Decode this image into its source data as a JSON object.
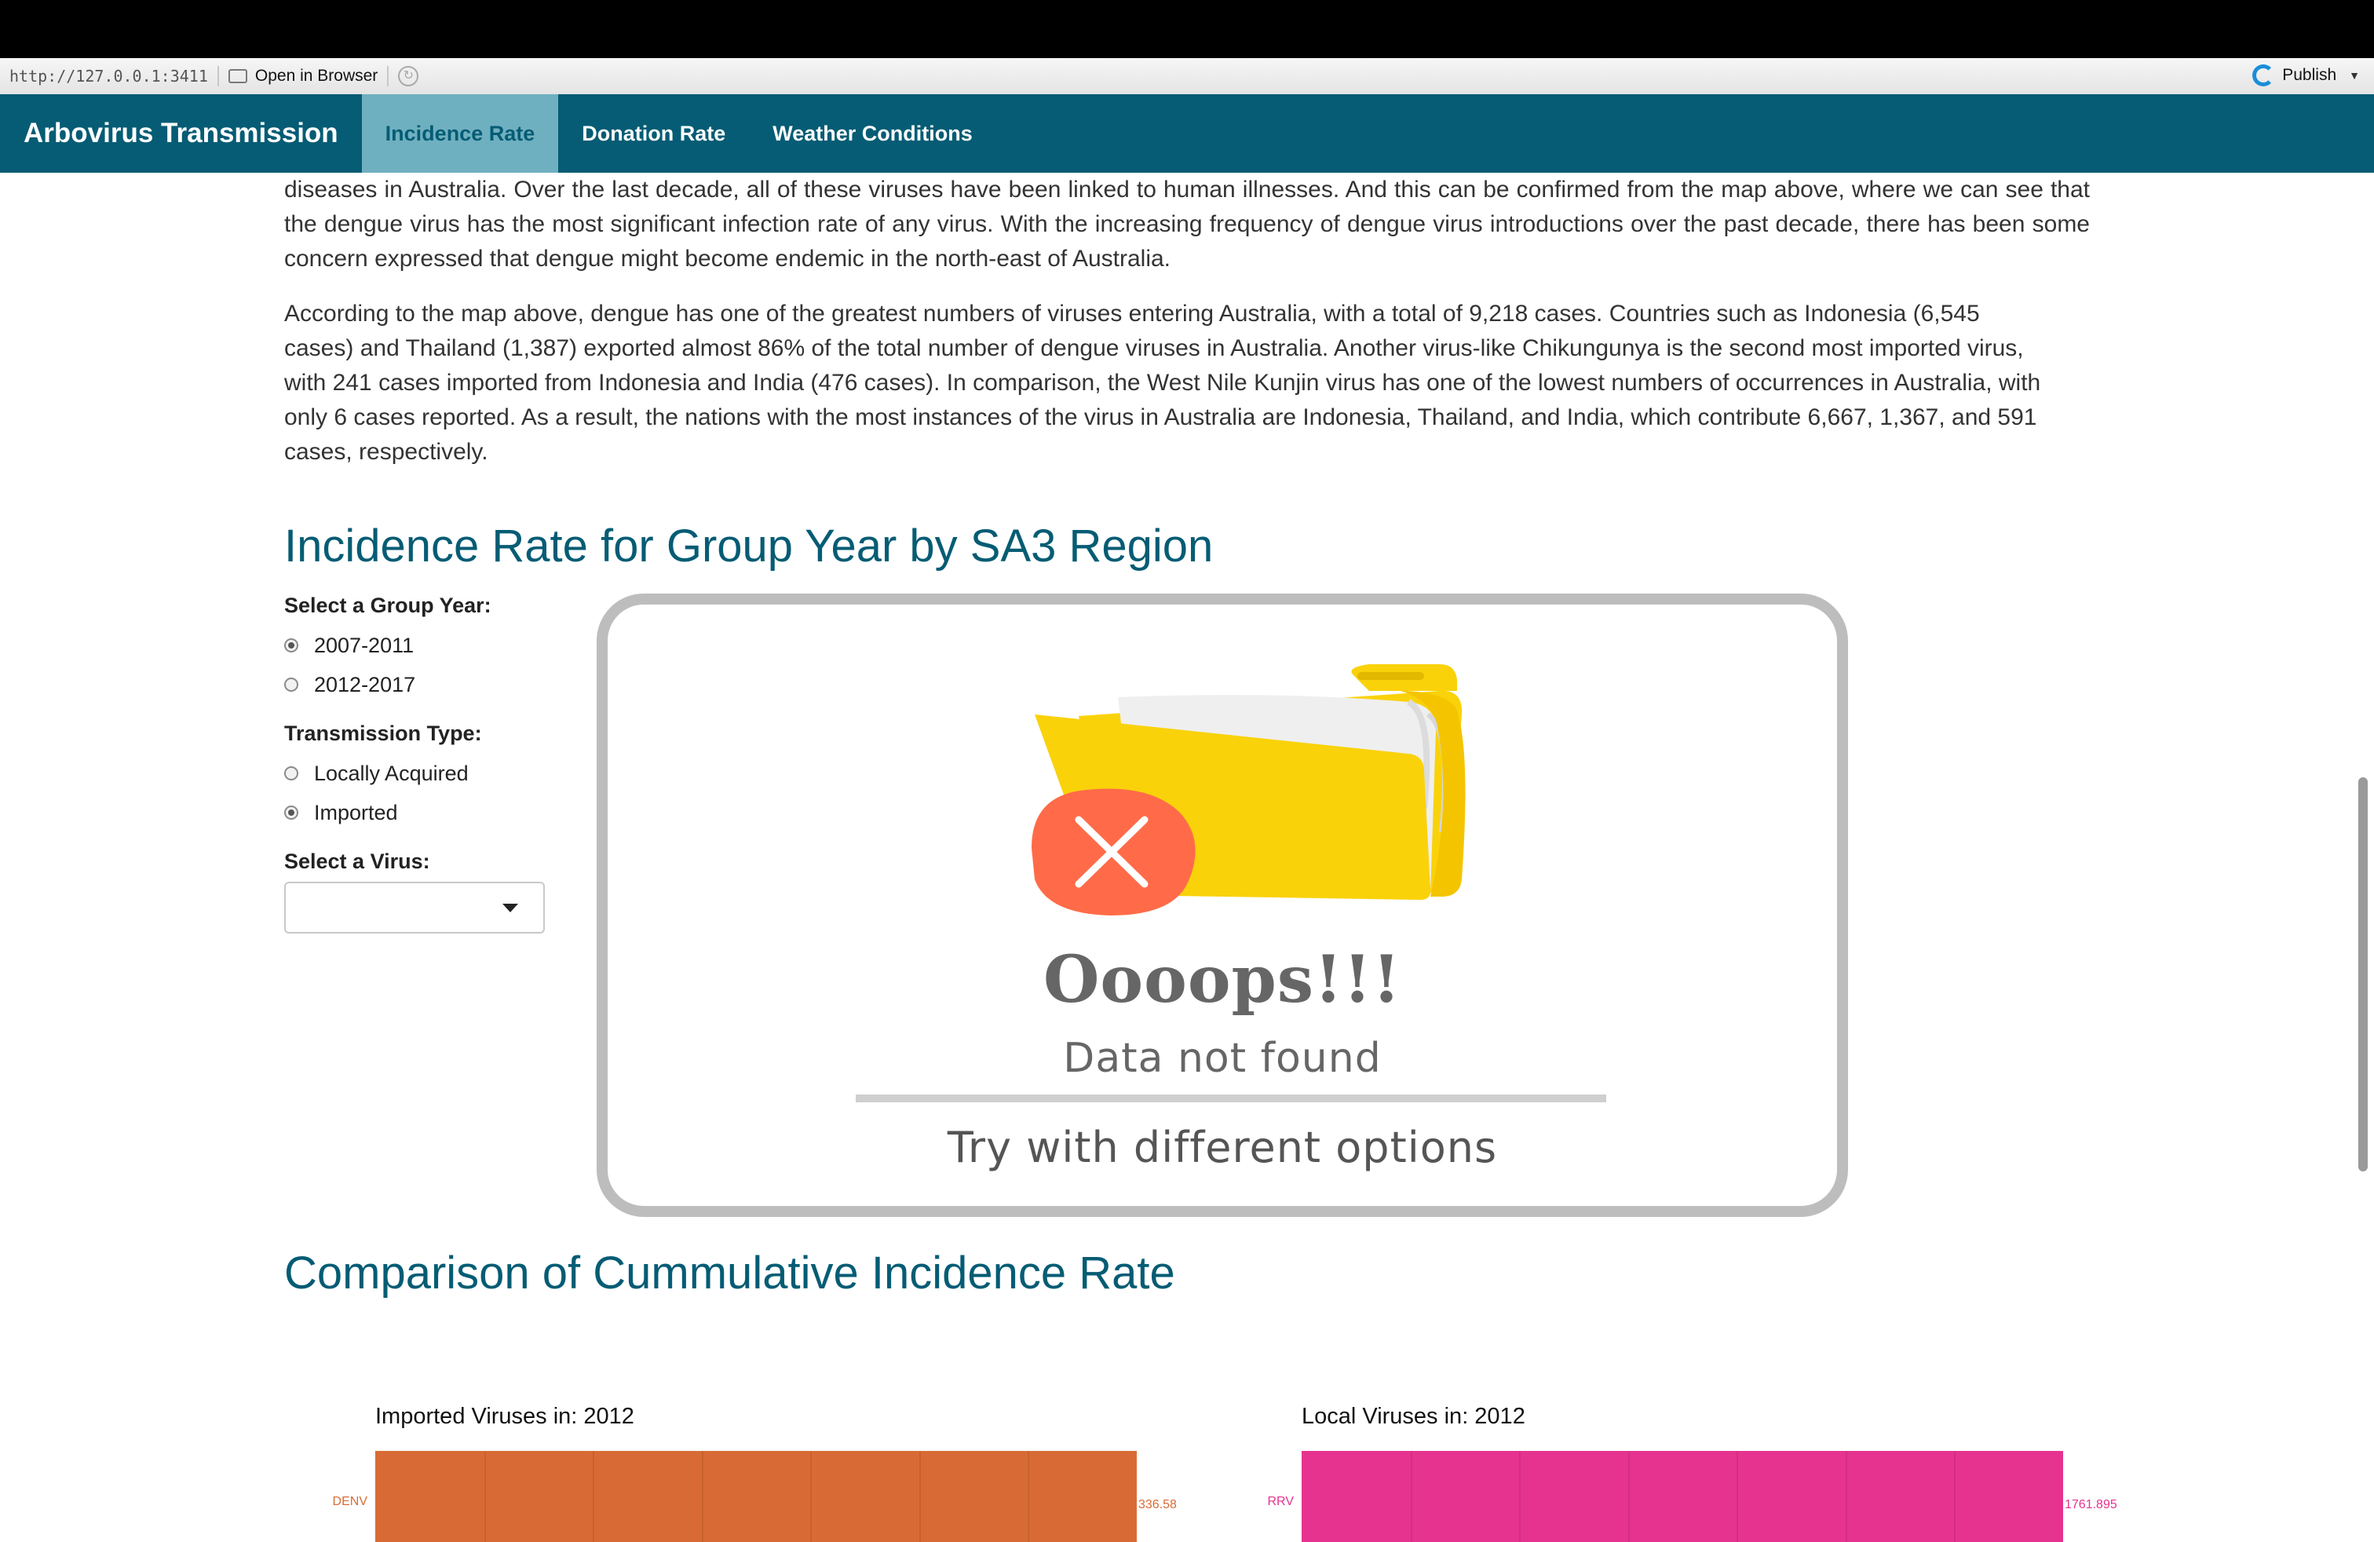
{
  "viewer": {
    "url": "http://127.0.0.1:3411",
    "open_in_browser": "Open in Browser",
    "publish": "Publish"
  },
  "nav": {
    "brand": "Arbovirus Transmission",
    "tabs": [
      {
        "label": "Incidence Rate"
      },
      {
        "label": "Donation Rate"
      },
      {
        "label": "Weather Conditions"
      }
    ]
  },
  "intro": {
    "para1": "diseases in Australia. Over the last decade, all of these viruses have been linked to human illnesses. And this can be confirmed from the map above, where we can see that the dengue virus has the most significant infection rate of any virus. With the increasing frequency of dengue virus introductions over the past decade, there has been some concern expressed that dengue might become endemic in the north-east of Australia.",
    "para2": "According to the map above, dengue has one of the greatest numbers of viruses entering Australia, with a total of 9,218 cases. Countries such as Indonesia (6,545 cases) and Thailand (1,387) exported almost 86% of the total number of dengue viruses in Australia. Another virus-like Chikungunya is the second most imported virus, with 241 cases imported from Indonesia and India (476 cases). In comparison, the West Nile Kunjin virus has one of the lowest numbers of occurrences in Australia, with only 6 cases reported. As a result, the nations with the most instances of the virus in Australia are Indonesia, Thailand, and India, which contribute 6,667, 1,367, and 591 cases, respectively."
  },
  "section1": {
    "title": "Incidence Rate for Group Year by SA3 Region",
    "group_year_label": "Select a Group Year:",
    "group_year_options": [
      "2007-2011",
      "2012-2017"
    ],
    "group_year_selected": "2007-2011",
    "transmission_label": "Transmission Type:",
    "transmission_options": [
      "Locally Acquired",
      "Imported"
    ],
    "transmission_selected": "Imported",
    "virus_label": "Select a Virus:",
    "virus_value": ""
  },
  "oops": {
    "title": "Oooops!!!",
    "subtitle": "Data not found",
    "hint": "Try with different options",
    "folder_color": "#f9d20a",
    "error_color": "#ff6b48"
  },
  "section2": {
    "title": "Comparison of Cummulative Incidence Rate"
  },
  "chart_data": [
    {
      "type": "bar",
      "title": "Imported Viruses in: 2012",
      "categories": [
        "DENV"
      ],
      "values": [
        336.58
      ],
      "value_labels": [
        "336.58"
      ],
      "color": "#d86b35"
    },
    {
      "type": "bar",
      "title": "Local Viruses in: 2012",
      "categories": [
        "RRV"
      ],
      "values": [
        1761.895
      ],
      "value_labels": [
        "1761.895"
      ],
      "color": "#e6338f"
    }
  ]
}
